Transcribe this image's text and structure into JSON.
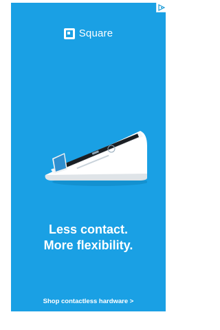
{
  "ad": {
    "brand": "Square",
    "headline_line1": "Less contact.",
    "headline_line2": "More flexibility.",
    "cta": "Shop contactless hardware >",
    "background_color": "#1aa0e4",
    "icons": [
      "adchoices-icon",
      "square-logo-icon",
      "card-terminal-image"
    ]
  }
}
